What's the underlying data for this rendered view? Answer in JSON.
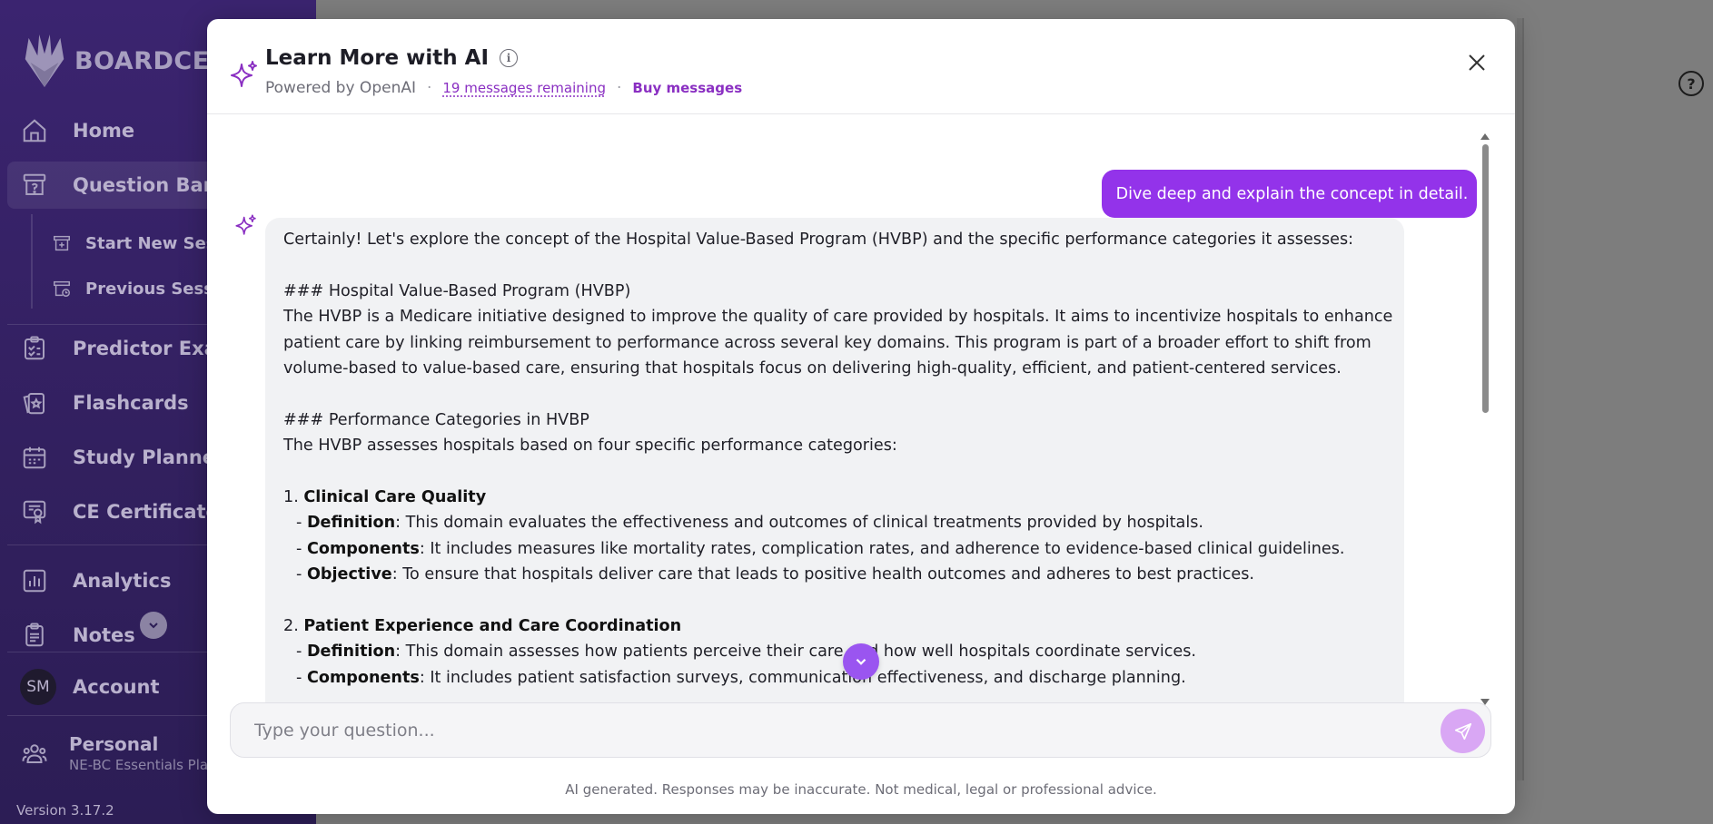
{
  "sidebar": {
    "logo_text": "BOARDCERT",
    "nav": [
      {
        "label": "Home",
        "icon": "home-icon"
      },
      {
        "label": "Question Bank",
        "icon": "question-bank-icon"
      },
      {
        "label": "Predictor Exam",
        "icon": "predictor-exam-icon"
      },
      {
        "label": "Flashcards",
        "icon": "flashcards-icon"
      },
      {
        "label": "Study Planner",
        "icon": "calendar-icon"
      },
      {
        "label": "CE Certificate",
        "icon": "certificate-icon"
      },
      {
        "label": "Analytics",
        "icon": "analytics-icon"
      },
      {
        "label": "Notes",
        "icon": "notes-icon"
      },
      {
        "label": "Account",
        "icon": "avatar"
      }
    ],
    "sub_items": [
      {
        "label": "Start New Session",
        "icon": "new-session-icon"
      },
      {
        "label": "Previous Sessions",
        "icon": "previous-sessions-icon"
      }
    ],
    "avatar_initials": "SM",
    "plan": {
      "name": "Personal",
      "detail": "NE-BC Essentials Plan"
    },
    "version": "Version 3.17.2"
  },
  "modal": {
    "title": "Learn More with AI",
    "powered_by": "Powered by OpenAI",
    "separator": "·",
    "messages_remaining": "19 messages remaining",
    "buy_messages": "Buy messages",
    "user_message": "Dive deep and explain the concept in detail.",
    "response": {
      "intro": "Certainly! Let's explore the concept of the Hospital Value-Based Program (HVBP) and the specific performance categories it assesses:",
      "h1": "### Hospital Value-Based Program (HVBP)",
      "p1": [
        "The HVBP is a Medicare initiative designed to improve the quality of care provided by hospitals. It aims to incentivize hospitals to enhance",
        "patient care by linking reimbursement to performance across several key domains. This program is part of a broader effort to shift from",
        "volume-based to value-based care, ensuring that hospitals focus on delivering high-quality, efficient, and patient-centered services."
      ],
      "h2": "### Performance Categories in HVBP",
      "p2": "The HVBP assesses hospitals based on four specific performance categories:",
      "items": [
        {
          "num": "1.",
          "title": "Clinical Care Quality",
          "bullets": [
            {
              "term": "Definition",
              "text": ": This domain evaluates the effectiveness and outcomes of clinical treatments provided by hospitals."
            },
            {
              "term": "Components",
              "text": ": It includes measures like mortality rates, complication rates, and adherence to evidence-based clinical guidelines."
            },
            {
              "term": "Objective",
              "text": ": To ensure that hospitals deliver care that leads to positive health outcomes and adheres to best practices."
            }
          ]
        },
        {
          "num": "2.",
          "title": "Patient Experience and Care Coordination",
          "bullets": [
            {
              "term": "Definition",
              "text": ": This domain assesses how patients perceive their care and how well hospitals coordinate services."
            },
            {
              "term": "Components",
              "text": ": It includes patient satisfaction surveys, communication effectiveness, and discharge planning."
            }
          ]
        }
      ],
      "bullet_prefix": "- "
    },
    "input_placeholder": "Type your question...",
    "disclaimer": "AI generated. Responses may be inaccurate. Not medical, legal or professional advice."
  },
  "background": {
    "help_symbol": "?"
  },
  "colors": {
    "accent": "#9333ea",
    "sidebar": "#3b2470",
    "send_button": "#d9a7f4"
  }
}
